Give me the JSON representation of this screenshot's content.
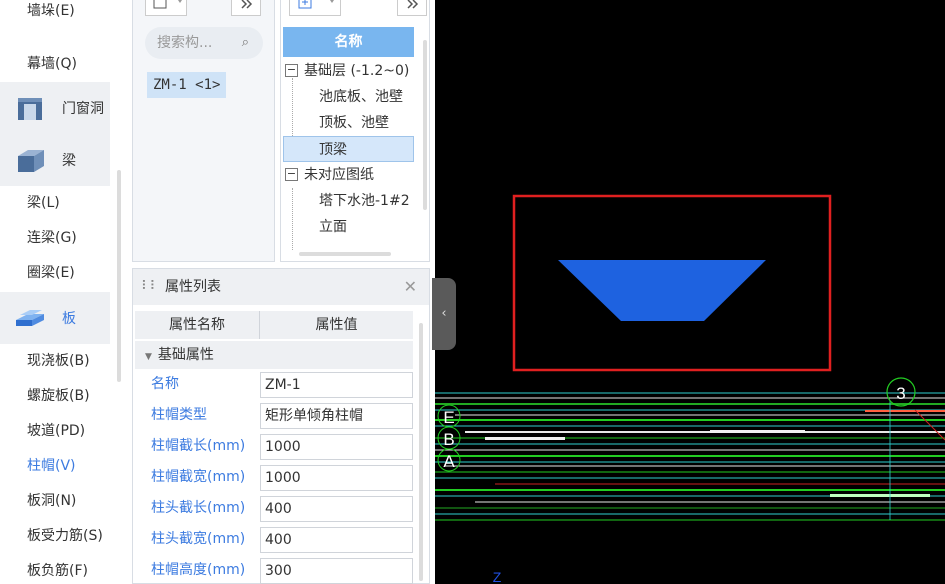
{
  "nav": {
    "items_top": [
      {
        "label": "墙垛(E)"
      },
      {
        "label": "幕墙(Q)"
      }
    ],
    "cat_door": {
      "label": "门窗洞"
    },
    "cat_beam": {
      "label": "梁"
    },
    "beam_items": [
      {
        "label": "梁(L)"
      },
      {
        "label": "连梁(G)"
      },
      {
        "label": "圈梁(E)"
      }
    ],
    "cat_slab": {
      "label": "板"
    },
    "slab_items": [
      {
        "label": "现浇板(B)"
      },
      {
        "label": "螺旋板(B)"
      },
      {
        "label": "坡道(PD)"
      },
      {
        "label": "柱帽(V)"
      },
      {
        "label": "板洞(N)"
      },
      {
        "label": "板受力筋(S)"
      },
      {
        "label": "板负筋(F)"
      }
    ],
    "active_item": "柱帽(V)",
    "accent_color": "#3c7be0"
  },
  "component": {
    "search_placeholder": "搜索构...",
    "selected": "ZM-1 <1>"
  },
  "tree": {
    "header": "名称",
    "nodes": [
      {
        "label": "基础层 (-1.2~0)",
        "toggle": "−"
      },
      {
        "label": "池底板、池壁"
      },
      {
        "label": "顶板、池壁"
      },
      {
        "label": "顶梁"
      },
      {
        "label": "未对应图纸",
        "toggle": "−"
      },
      {
        "label": "塔下水池-1#2"
      },
      {
        "label": "立面"
      }
    ]
  },
  "props": {
    "title": "属性列表",
    "col_name": "属性名称",
    "col_value": "属性值",
    "group": "基础属性",
    "rows": [
      {
        "name": "名称",
        "value": "ZM-1"
      },
      {
        "name": "柱帽类型",
        "value": "矩形单倾角柱帽"
      },
      {
        "name": "柱帽截长(mm)",
        "value": "1000"
      },
      {
        "name": "柱帽截宽(mm)",
        "value": "1000"
      },
      {
        "name": "柱头截长(mm)",
        "value": "400"
      },
      {
        "name": "柱头截宽(mm)",
        "value": "400"
      },
      {
        "name": "柱帽高度(mm)",
        "value": "300"
      }
    ]
  },
  "canvas": {
    "axis_labels": [
      "3",
      "E",
      "B",
      "A",
      "Z"
    ],
    "shape_color": "#1e62e0",
    "highlight_color": "#e02020"
  }
}
